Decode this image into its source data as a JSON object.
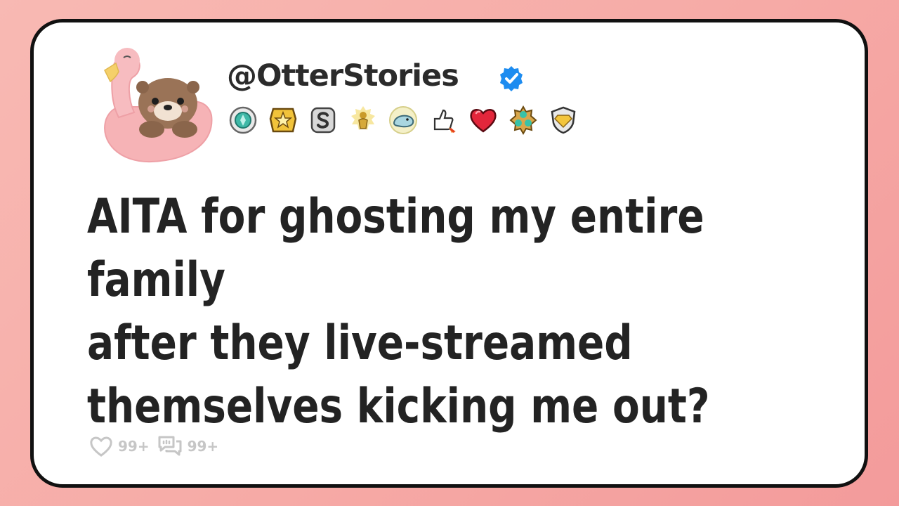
{
  "post": {
    "username": "@OtterStories",
    "verified_icon": "verified-check-icon",
    "title": "AITA for ghosting my entire family\nafter they live-streamed\nthemselves kicking me out?",
    "likes": "99+",
    "comments": "99+"
  },
  "badges": [
    "diamond-medal-icon",
    "gold-star-icon",
    "silver-s-icon",
    "gold-trophy-icon",
    "seal-icon",
    "thumbs-up-rocket-icon",
    "heart-icon",
    "triple-gem-icon",
    "gold-shield-icon"
  ],
  "colors": {
    "background": "#f6aaa6",
    "card": "#ffffff",
    "border": "#111111",
    "text": "#232323",
    "verified": "#1d8cf0",
    "stats": "#c6c6c6"
  }
}
